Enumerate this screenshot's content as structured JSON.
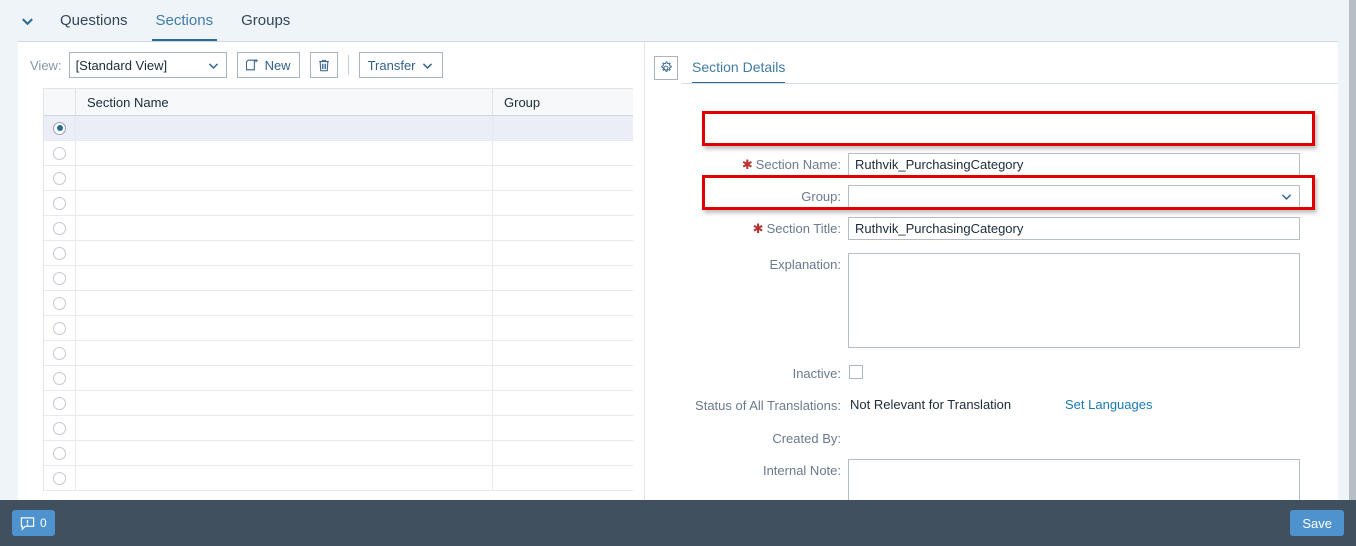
{
  "tabs": {
    "collapse_icon": "chevron-down-icon",
    "items": [
      {
        "label": "Questions",
        "active": false
      },
      {
        "label": "Sections",
        "active": true
      },
      {
        "label": "Groups",
        "active": false
      }
    ]
  },
  "toolbar": {
    "view_label": "View:",
    "view_value": "[Standard View]",
    "new_label": "New",
    "new_icon": "new-document-icon",
    "delete_icon": "trash-icon",
    "transfer_label": "Transfer",
    "transfer_icon": "chevron-down-icon"
  },
  "table": {
    "columns": [
      "",
      "Section Name",
      "Group"
    ],
    "rows": [
      {
        "selected": true,
        "section_name": "",
        "group": ""
      },
      {
        "selected": false,
        "section_name": "",
        "group": ""
      },
      {
        "selected": false,
        "section_name": "",
        "group": ""
      },
      {
        "selected": false,
        "section_name": "",
        "group": ""
      },
      {
        "selected": false,
        "section_name": "",
        "group": ""
      },
      {
        "selected": false,
        "section_name": "",
        "group": ""
      },
      {
        "selected": false,
        "section_name": "",
        "group": ""
      },
      {
        "selected": false,
        "section_name": "",
        "group": ""
      },
      {
        "selected": false,
        "section_name": "",
        "group": ""
      },
      {
        "selected": false,
        "section_name": "",
        "group": ""
      },
      {
        "selected": false,
        "section_name": "",
        "group": ""
      },
      {
        "selected": false,
        "section_name": "",
        "group": ""
      },
      {
        "selected": false,
        "section_name": "",
        "group": ""
      },
      {
        "selected": false,
        "section_name": "",
        "group": ""
      },
      {
        "selected": false,
        "section_name": "",
        "group": ""
      }
    ]
  },
  "details": {
    "settings_icon": "gear-icon",
    "tab_label": "Section Details",
    "fields": {
      "section_name": {
        "label": "Section Name:",
        "required": true,
        "value": "Ruthvik_PurchasingCategory",
        "highlighted": true
      },
      "group": {
        "label": "Group:",
        "required": false,
        "value": "",
        "dropdown_icon": "chevron-down-icon"
      },
      "section_title": {
        "label": "Section Title:",
        "required": true,
        "value": "Ruthvik_PurchasingCategory",
        "highlighted": true
      },
      "explanation": {
        "label": "Explanation:",
        "value": ""
      },
      "inactive": {
        "label": "Inactive:",
        "checked": false
      },
      "status_of_all_translations": {
        "label": "Status of All Translations:",
        "value": "Not Relevant for Translation",
        "link_label": "Set Languages"
      },
      "created_by": {
        "label": "Created By:",
        "value": ""
      },
      "internal_note": {
        "label": "Internal Note:",
        "value": ""
      }
    }
  },
  "footer": {
    "message_icon": "message-alert-icon",
    "message_count": "0",
    "save_label": "Save"
  },
  "colors": {
    "accent_blue": "#4f93ce",
    "tab_active": "#2b6a94",
    "link": "#1b7ab5",
    "highlight_red": "#e00000",
    "footer_bg": "#41505f",
    "page_bg": "#eff4f9",
    "required_star": "#b8312f"
  }
}
